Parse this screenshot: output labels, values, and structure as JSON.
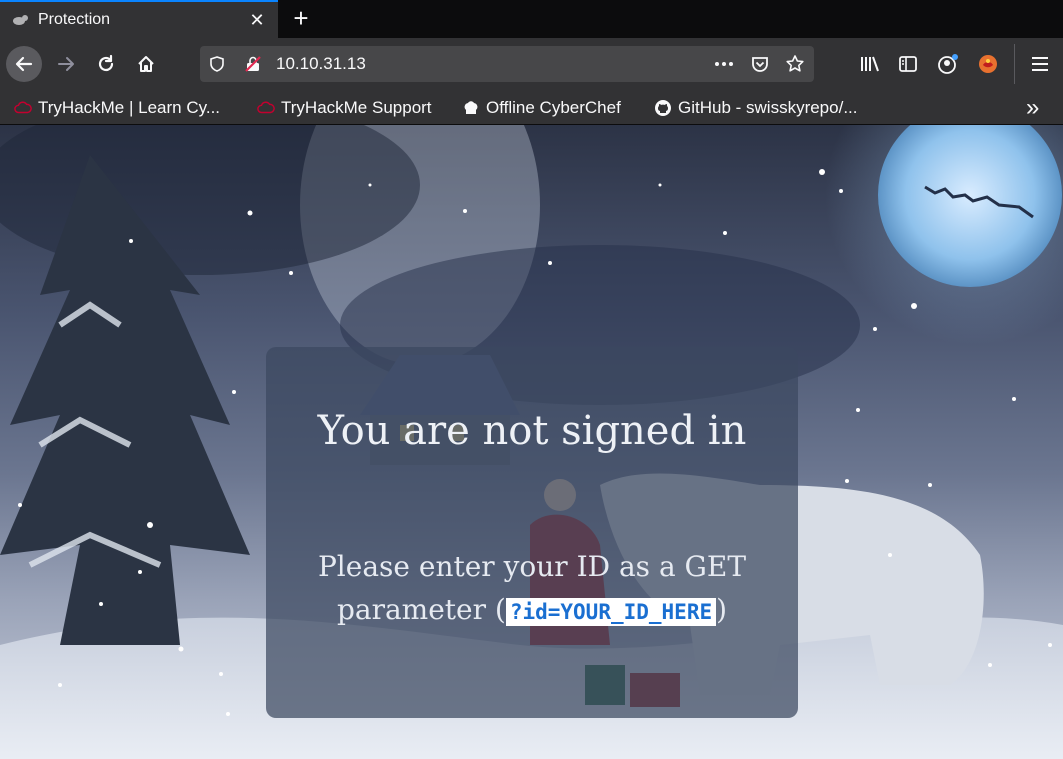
{
  "tab": {
    "title": "Protection"
  },
  "address_bar": {
    "url": "10.10.31.13"
  },
  "bookmarks": [
    {
      "label": "TryHackMe | Learn Cy..."
    },
    {
      "label": "TryHackMe Support"
    },
    {
      "label": "Offline CyberChef"
    },
    {
      "label": "GitHub - swisskyrepo/..."
    }
  ],
  "page": {
    "heading": "You are not signed in",
    "message_before": "Please enter your ID as a GET parameter (",
    "message_code": "?id=YOUR_ID_HERE",
    "message_after": ")"
  },
  "colors": {
    "accent": "#0a84ff",
    "code_text": "#1a6fd1"
  }
}
